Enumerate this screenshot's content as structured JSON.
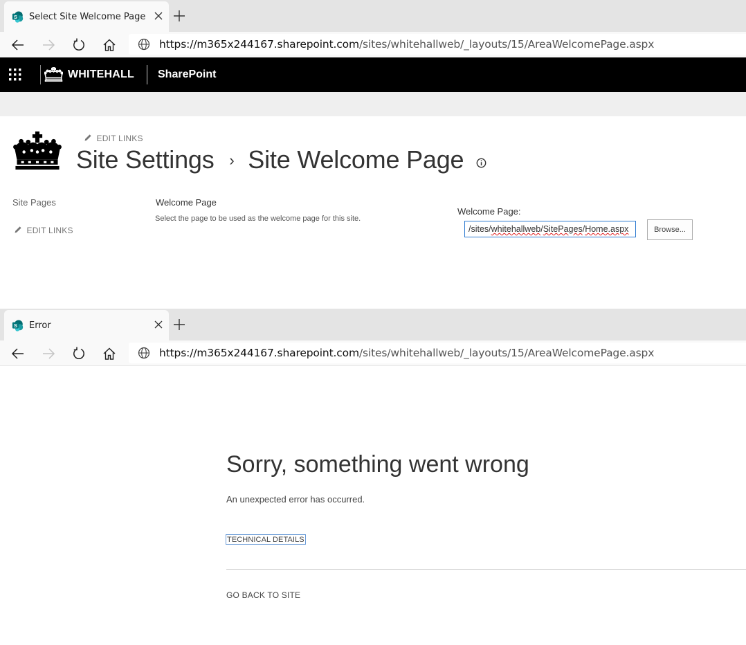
{
  "window1": {
    "tab_title": "Select Site Welcome Page",
    "url_domain": "https://m365x244167.sharepoint.com",
    "url_path": "/sites/whitehallweb/_layouts/15/AreaWelcomePage.aspx"
  },
  "suite_bar": {
    "brand": "WHITEHALL",
    "app_name": "SharePoint"
  },
  "site_header": {
    "edit_links": "EDIT LINKS",
    "breadcrumb_parent": "Site Settings",
    "breadcrumb_separator": "›",
    "page_title": "Site Welcome Page"
  },
  "left_nav": {
    "items": [
      {
        "label": "Site Pages"
      }
    ],
    "edit_links": "EDIT LINKS"
  },
  "welcome_section": {
    "heading": "Welcome Page",
    "description": "Select the page to be used as the welcome page for this site.",
    "field_label": "Welcome Page:",
    "field_value_parts": [
      "/sites/",
      "whitehallweb",
      "/",
      "SitePages",
      "/",
      "Home.aspx"
    ],
    "browse_label": "Browse..."
  },
  "window2": {
    "tab_title": "Error",
    "url_domain": "https://m365x244167.sharepoint.com",
    "url_path": "/sites/whitehallweb/_layouts/15/AreaWelcomePage.aspx"
  },
  "error_page": {
    "title": "Sorry, something went wrong",
    "message": "An unexpected error has occurred.",
    "technical_details": "TECHNICAL DETAILS",
    "go_back": "GO BACK TO SITE"
  },
  "icons": {
    "favicon": "sharepoint-icon",
    "close": "close-icon",
    "new_tab": "plus-icon",
    "back": "back-arrow-icon",
    "forward": "forward-arrow-icon",
    "refresh": "refresh-icon",
    "home": "home-icon",
    "site_info": "globe-icon",
    "app_launcher": "waffle-icon",
    "logo": "crown-icon",
    "edit": "pencil-icon",
    "info": "info-icon"
  },
  "colors": {
    "sharepoint_teal": "#038387",
    "suite_bar_bg": "#000000",
    "focus_blue": "#2b79d0"
  }
}
